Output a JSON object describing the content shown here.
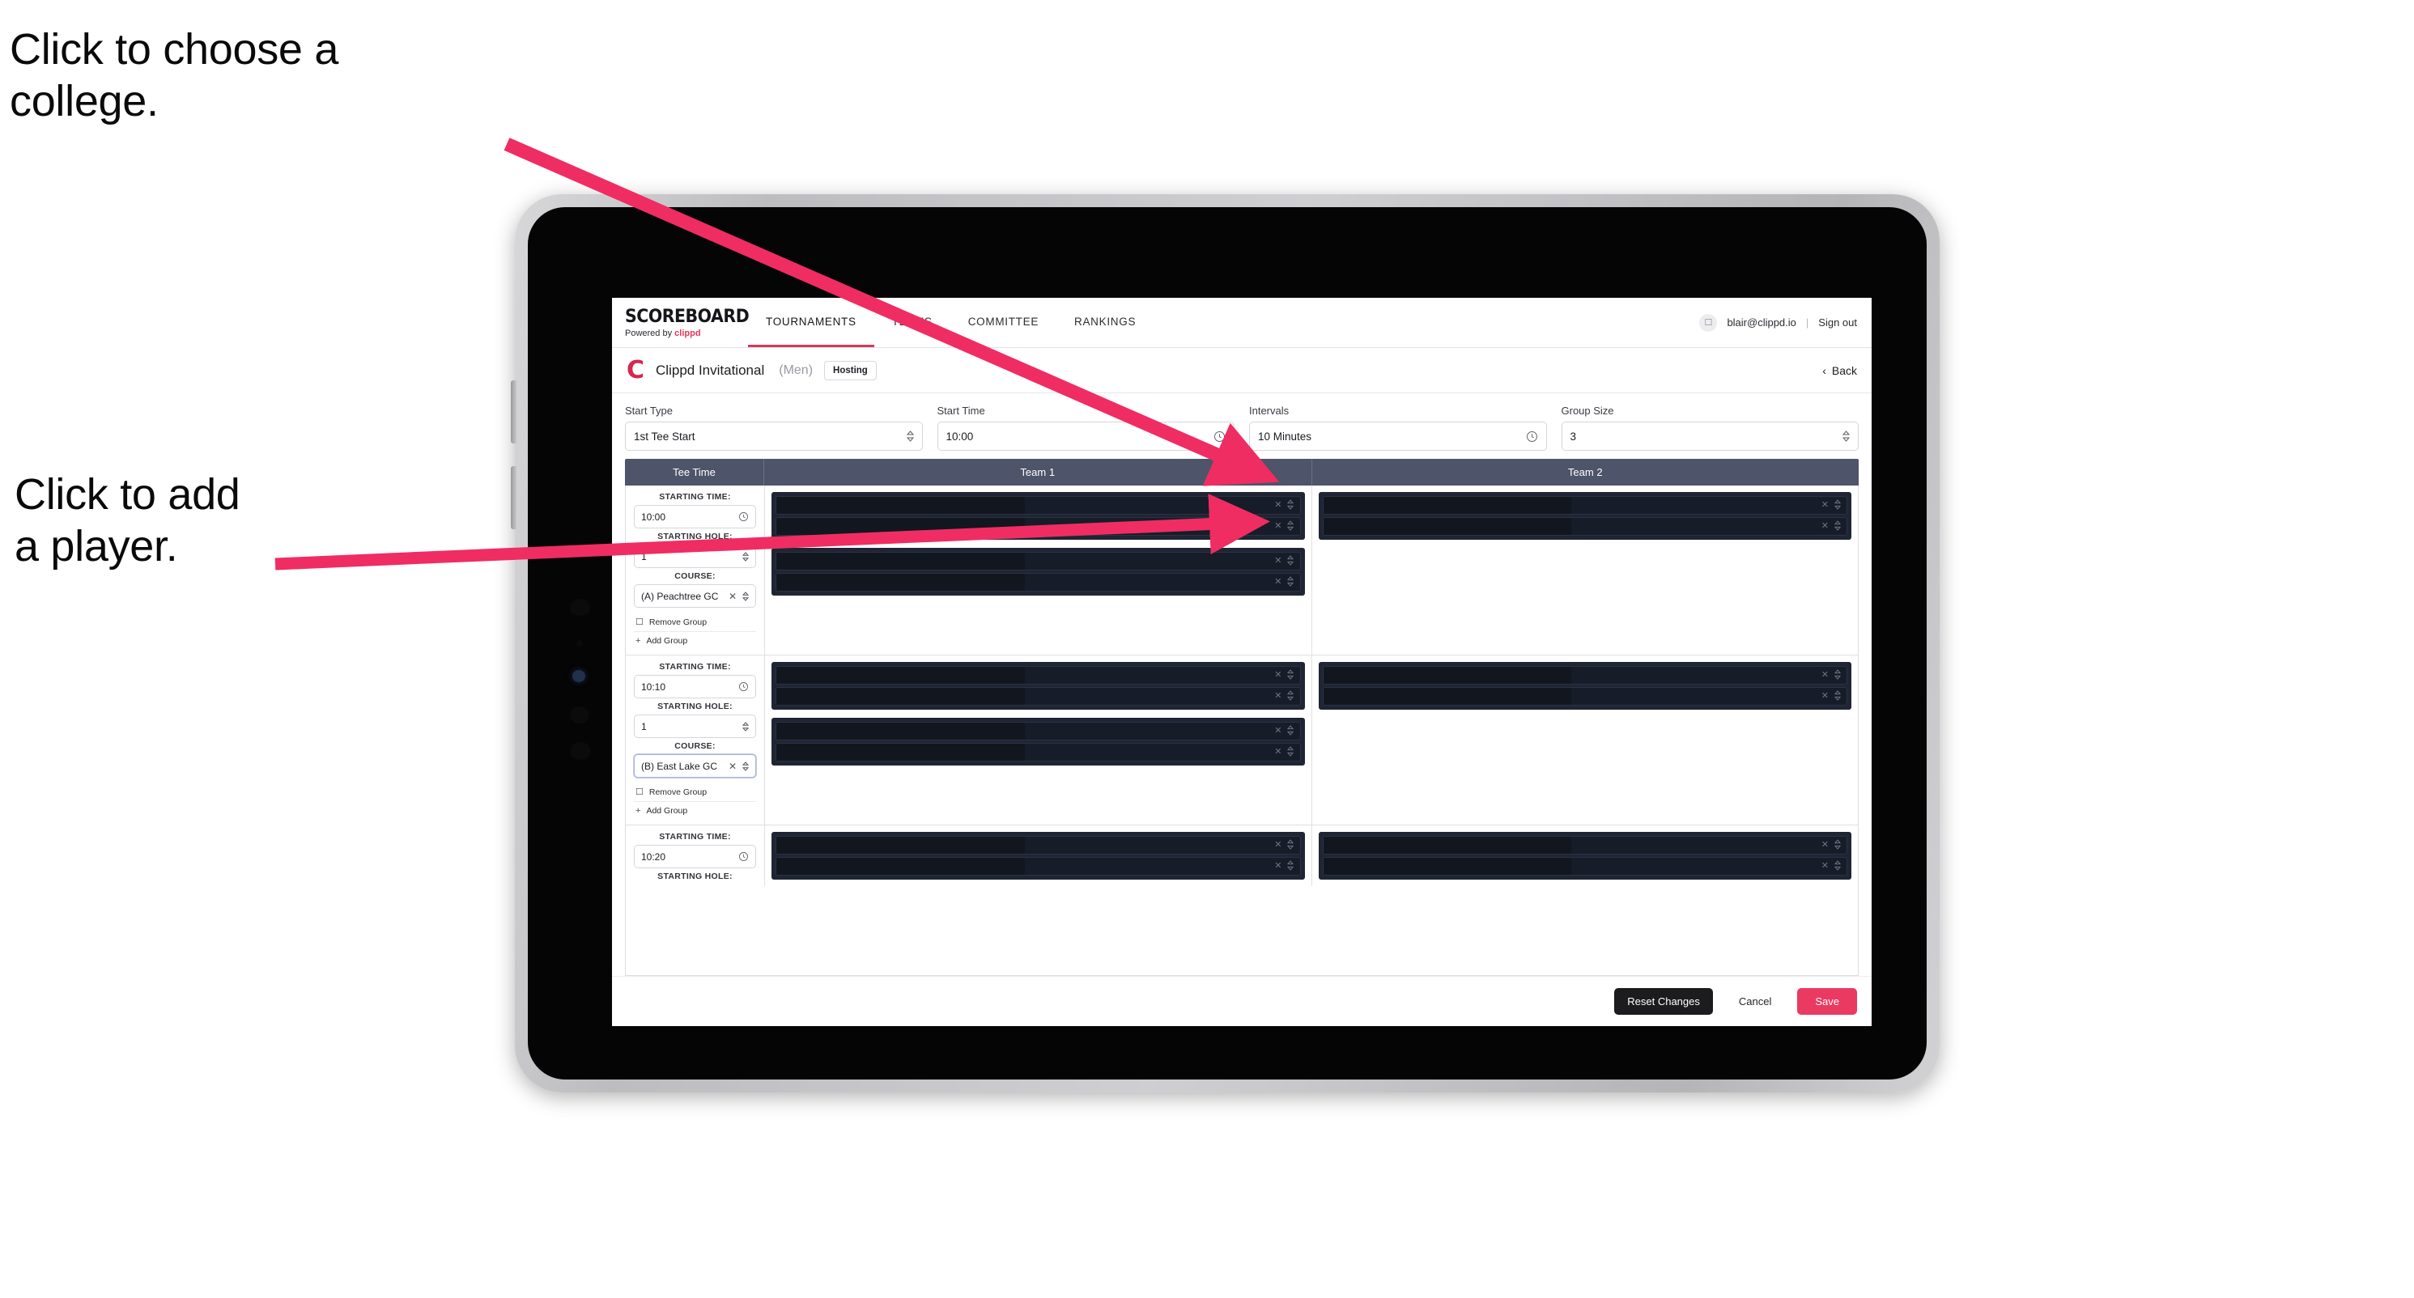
{
  "annotations": {
    "college": "Click to choose a\ncollege.",
    "player": "Click to add\na player."
  },
  "app": {
    "brand": {
      "title": "SCOREBOARD",
      "powered_prefix": "Powered by ",
      "powered_brand": "clippd"
    },
    "nav_tabs": [
      {
        "label": "TOURNAMENTS",
        "active": true
      },
      {
        "label": "TEAMS",
        "active": false
      },
      {
        "label": "COMMITTEE",
        "active": false
      },
      {
        "label": "RANKINGS",
        "active": false
      }
    ],
    "account": {
      "avatar_icon": "user-icon",
      "email": "blair@clippd.io",
      "separator": "|",
      "sign_out": "Sign out"
    },
    "subheader": {
      "logo": "C",
      "event_name": "Clippd Invitational",
      "gender": "(Men)",
      "badge": "Hosting",
      "back": "Back",
      "back_icon": "chevron-left-icon"
    },
    "controls": [
      {
        "label": "Start Type",
        "value": "1st Tee Start",
        "icon": "chevron-updown-icon"
      },
      {
        "label": "Start Time",
        "value": "10:00",
        "icon": "clock-icon"
      },
      {
        "label": "Intervals",
        "value": "10 Minutes",
        "icon": "clock-icon"
      },
      {
        "label": "Group Size",
        "value": "3",
        "icon": "chevron-updown-icon"
      }
    ],
    "table": {
      "headers": {
        "tee_time": "Tee Time",
        "team1": "Team 1",
        "team2": "Team 2"
      },
      "labels": {
        "starting_time": "STARTING TIME:",
        "starting_hole": "STARTING HOLE:",
        "course": "COURSE:"
      },
      "actions": {
        "remove_group": "Remove Group",
        "add_group": "Add Group",
        "remove_icon": "trash-icon",
        "add_icon": "plus-icon"
      },
      "slot_icons": {
        "clear": "close-icon",
        "select": "chevron-updown-icon"
      },
      "rows": [
        {
          "starting_time": "10:00",
          "starting_hole": "1",
          "course": "(A) Peachtree GC",
          "course_focused": false,
          "team1_groups": [
            2,
            2
          ],
          "team2_groups": [
            2
          ]
        },
        {
          "starting_time": "10:10",
          "starting_hole": "1",
          "course": "(B) East Lake GC",
          "course_focused": true,
          "team1_groups": [
            2,
            2
          ],
          "team2_groups": [
            2
          ]
        },
        {
          "starting_time": "10:20",
          "starting_hole": "",
          "course": "",
          "course_focused": false,
          "team1_groups": [
            2
          ],
          "team2_groups": [
            2
          ]
        }
      ]
    },
    "footer": {
      "reset": "Reset Changes",
      "cancel": "Cancel",
      "save": "Save"
    }
  },
  "colors": {
    "accent": "#ea3a62",
    "arrow": "#ef2d63",
    "header_bar": "#4e5469",
    "dark_panel": "#1f2533"
  }
}
